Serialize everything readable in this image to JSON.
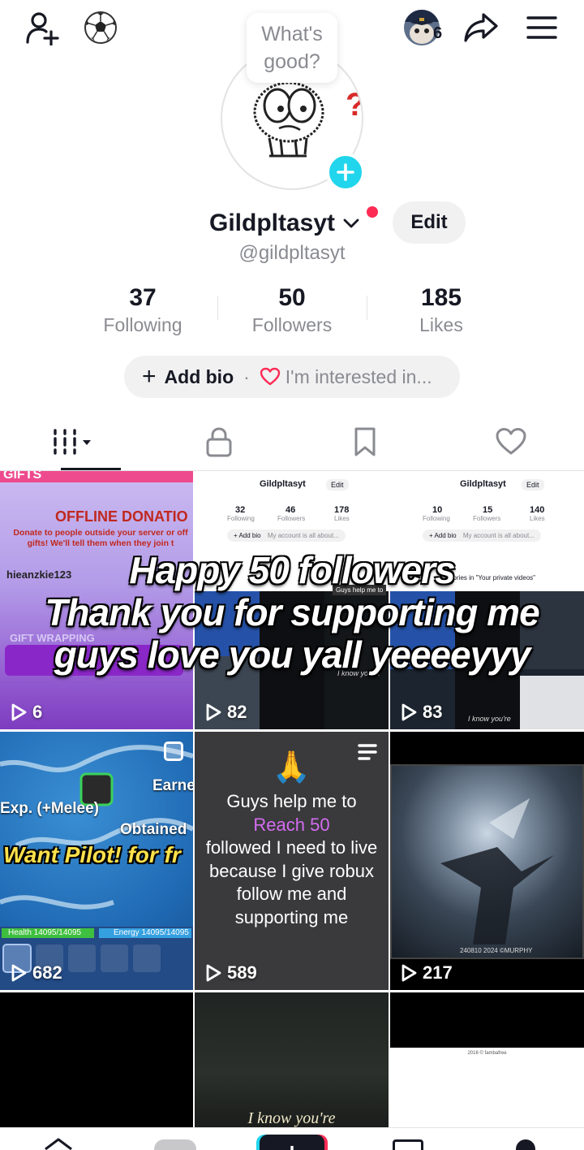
{
  "top_bar": {
    "avatar_count": "6"
  },
  "profile": {
    "bubble_text": "What's good?",
    "username": "Gildpltasyt",
    "handle": "@gildpltasyt",
    "edit_label": "Edit"
  },
  "stats": [
    {
      "value": "37",
      "label": "Following"
    },
    {
      "value": "50",
      "label": "Followers"
    },
    {
      "value": "185",
      "label": "Likes"
    }
  ],
  "bio": {
    "add_label": "Add bio",
    "separator": "·",
    "interest_label": "I'm interested in..."
  },
  "tabs": [
    {
      "icon": "videos-grid-icon"
    },
    {
      "icon": "lock-icon"
    },
    {
      "icon": "bookmark-icon"
    },
    {
      "icon": "heart-icon"
    }
  ],
  "videos": [
    {
      "views": "6",
      "thumb_banner": "GIFTS",
      "thumb_title": "OFFLINE DONATIO",
      "thumb_text": "Donate to people outside your server or off gifts! We'll tell them when they join t",
      "thumb_user": "hieanzkie123",
      "thumb_footer": "GIFT WRAPPING"
    },
    {
      "views": "82",
      "mini_name": "Gildpltasyt",
      "mini_edit": "Edit",
      "mini_stats": [
        [
          "32",
          "Following"
        ],
        [
          "46",
          "Followers"
        ],
        [
          "178",
          "Likes"
        ]
      ],
      "mini_bio": "+ Add bio",
      "mini_bio_extra": "My account is all about...",
      "mini_caption": "Guys help me to",
      "mini_small_caption": "I know you're"
    },
    {
      "views": "83",
      "mini_name": "Gildpltasyt",
      "mini_edit": "Edit",
      "mini_stats": [
        [
          "10",
          "Following"
        ],
        [
          "15",
          "Followers"
        ],
        [
          "140",
          "Likes"
        ]
      ],
      "mini_bio": "+ Add bio",
      "mini_bio_extra": "My account is all about...",
      "mini_banner": "Stories in \"Your private videos\"",
      "mini_small_caption": "I know you're"
    },
    {
      "views": "682",
      "game_earned": "Earne",
      "game_exp": "Exp. (+Melee)",
      "game_obtained": "Obtained",
      "game_title": "Want Pilot! for fr",
      "game_health": "Health 14095/14095",
      "game_energy": "Energy 14095/14095"
    },
    {
      "views": "589",
      "emoji": "🙏",
      "caption_line1": "Guys help me to",
      "caption_highlight": "Reach 50",
      "caption_rest": "followed I need to live because I give robux follow me and supporting me"
    },
    {
      "views": "217",
      "watermark": "240810 2024 ©MURPHY"
    },
    {
      "views": ""
    },
    {
      "views": "",
      "caption": "I know you're"
    },
    {
      "views": "",
      "caption": "2016 © fambafree"
    }
  ],
  "overlay_caption": {
    "line1": "Happy 50 followers",
    "line2": "Thank you for supporting me",
    "line3": "guys love you yall yeeeeyyy"
  },
  "colors": {
    "accent_pink": "#fe2c55",
    "accent_cyan": "#20d5ec",
    "text_primary": "#161823",
    "text_secondary": "#8a8b91",
    "pill_bg": "#f1f1f2"
  }
}
